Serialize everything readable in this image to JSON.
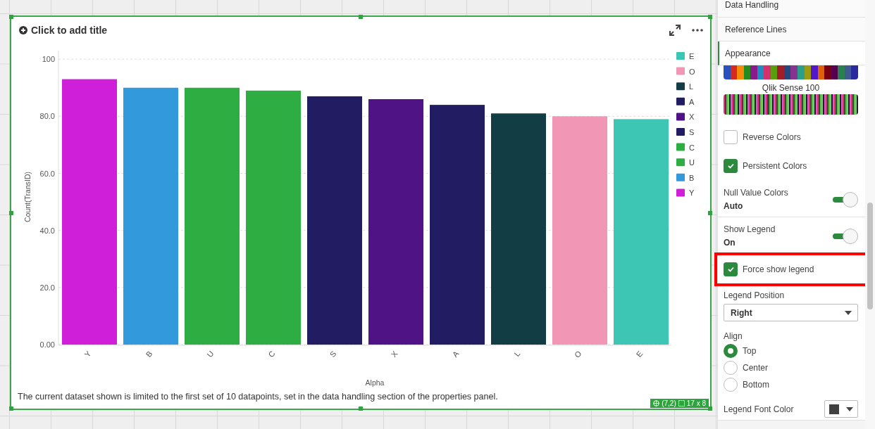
{
  "chart_card": {
    "title_placeholder": "Click to add title",
    "selected": true,
    "chart_data": {
      "type": "bar",
      "xlabel": "Alpha",
      "ylabel": "Count(TransID)",
      "categories": [
        "Y",
        "B",
        "U",
        "C",
        "S",
        "X",
        "A",
        "L",
        "O",
        "E"
      ],
      "values": [
        93,
        90,
        90,
        89,
        87,
        86,
        84,
        81,
        80,
        79
      ],
      "colors": [
        "#d01fd8",
        "#3399dd",
        "#2eae42",
        "#2eae42",
        "#221c63",
        "#4f1385",
        "#221c63",
        "#133d44",
        "#f197b5",
        "#3ec6b4"
      ],
      "ylim": [
        0,
        103
      ],
      "grid": true,
      "yticks": [
        {
          "value": 0,
          "label": "0.00"
        },
        {
          "value": 20,
          "label": "20.0"
        },
        {
          "value": 40,
          "label": "40.0"
        },
        {
          "value": 60,
          "label": "60.0"
        },
        {
          "value": 80,
          "label": "80.0"
        },
        {
          "value": 100,
          "label": "100"
        }
      ]
    },
    "legend": [
      {
        "label": "E",
        "color": "#3ec6b4"
      },
      {
        "label": "O",
        "color": "#f197b5"
      },
      {
        "label": "L",
        "color": "#133d44"
      },
      {
        "label": "A",
        "color": "#221c63"
      },
      {
        "label": "X",
        "color": "#4f1385"
      },
      {
        "label": "S",
        "color": "#221c63"
      },
      {
        "label": "C",
        "color": "#2eae42"
      },
      {
        "label": "U",
        "color": "#2eae42"
      },
      {
        "label": "B",
        "color": "#3399dd"
      },
      {
        "label": "Y",
        "color": "#d01fd8"
      }
    ],
    "footnote": "The current dataset shown is limited to the first set of 10 datapoints, set in the data handling section of the properties panel.",
    "position_badge": {
      "cell": "(7,2)",
      "size": "17 x 8"
    }
  },
  "properties_panel": {
    "sections": [
      {
        "label": "Data Handling",
        "selected": false
      },
      {
        "label": "Reference Lines",
        "selected": false
      },
      {
        "label": "Appearance",
        "selected": true
      }
    ],
    "color_scheme_name": "Qlik Sense 100",
    "settings": [
      {
        "kind": "checkbox",
        "label": "Reverse Colors",
        "checked": false,
        "highlighted": false
      },
      {
        "kind": "checkbox",
        "label": "Persistent Colors",
        "checked": true,
        "highlighted": false
      },
      {
        "kind": "toggle",
        "label": "Null Value Colors",
        "value": "Auto",
        "on": true
      },
      {
        "kind": "toggle",
        "label": "Show Legend",
        "value": "On",
        "on": true
      },
      {
        "kind": "checkbox",
        "label": "Force show legend",
        "checked": true,
        "highlighted": true
      },
      {
        "kind": "dropdown",
        "label": "Legend Position",
        "value": "Right"
      },
      {
        "kind": "radio_group",
        "label": "Align",
        "options": [
          {
            "label": "Top",
            "selected": true
          },
          {
            "label": "Center",
            "selected": false
          },
          {
            "label": "Bottom",
            "selected": false
          }
        ]
      },
      {
        "kind": "color_picker",
        "label": "Legend Font Color",
        "color": "#404040"
      }
    ]
  }
}
